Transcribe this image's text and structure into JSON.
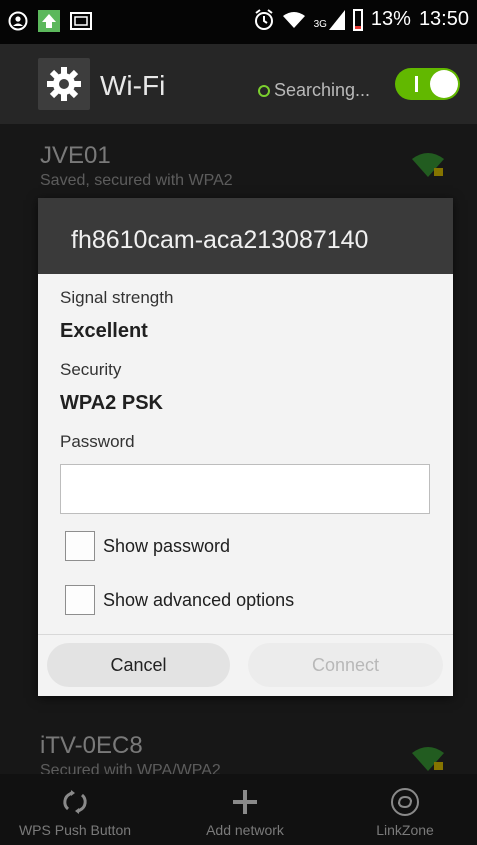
{
  "status_bar": {
    "battery_percent": "13%",
    "time": "13:50",
    "network_type": "3G"
  },
  "action_bar": {
    "title": "Wi-Fi",
    "status": "Searching...",
    "toggle_on": true
  },
  "networks": [
    {
      "ssid": "JVE01",
      "subtitle": "Saved, secured with WPA2"
    },
    {
      "ssid": "iTV-0EC8",
      "subtitle": "Secured with WPA/WPA2"
    }
  ],
  "dialog": {
    "title": "fh8610cam-aca213087140",
    "signal_label": "Signal strength",
    "signal_value": "Excellent",
    "security_label": "Security",
    "security_value": "WPA2 PSK",
    "password_label": "Password",
    "password_value": "",
    "show_password_label": "Show password",
    "show_advanced_label": "Show advanced options",
    "cancel_label": "Cancel",
    "connect_label": "Connect"
  },
  "bottom_bar": {
    "items": [
      {
        "label": "WPS Push Button",
        "icon": "wps-icon"
      },
      {
        "label": "Add network",
        "icon": "plus-icon"
      },
      {
        "label": "LinkZone",
        "icon": "linkzone-icon"
      }
    ]
  },
  "colors": {
    "accent_green": "#62b800",
    "wifi_icon_green": "#3fa83b",
    "dialog_header": "#3a3a3a"
  }
}
